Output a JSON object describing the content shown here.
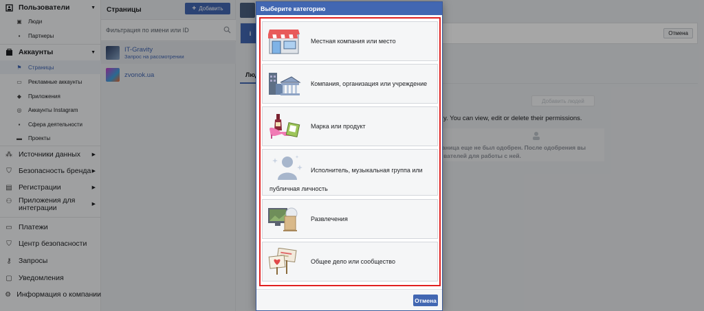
{
  "sidebar": {
    "users_section": "Пользователи",
    "people": "Люди",
    "partners": "Партнеры",
    "accounts_section": "Аккаунты",
    "pages": "Страницы",
    "ad_accounts": "Рекламные аккаунты",
    "apps": "Приложения",
    "instagram_accounts": "Аккаунты Instagram",
    "lines_of_business": "Сфера деятельности",
    "projects": "Проекты",
    "data_sources": "Источники данных",
    "brand_safety": "Безопасность бренда",
    "registrations": "Регистрации",
    "integrations": "Приложения для интеграции",
    "payments": "Платежи",
    "security_center": "Центр безопасности",
    "requests": "Запросы",
    "notifications": "Уведомления",
    "business_info": "Информация о компании"
  },
  "pages_panel": {
    "title": "Страницы",
    "add_button": "Добавить",
    "filter_placeholder": "Фильтрация по имени или ID",
    "items": [
      {
        "name": "IT-Gravity",
        "status": "Запрос на рассмотрении"
      },
      {
        "name": "zvonok.ua",
        "status": ""
      }
    ]
  },
  "main": {
    "cancel_button": "Отмена",
    "tab_people": "Люди",
    "add_people_button": "Добавить людей",
    "permissions_text": "y. You can view, edit or delete their permissions.",
    "notice_line1": "аница еще не был одобрен. После одобрения вы",
    "notice_line2": "вателей для работы с ней."
  },
  "dialog": {
    "title": "Выберите категорию",
    "categories": [
      {
        "label": "Местная компания или место",
        "icon": "storefront-icon"
      },
      {
        "label": "Компания, организация или учреждение",
        "icon": "institution-icon"
      },
      {
        "label": "Марка или продукт",
        "icon": "product-icon"
      },
      {
        "label": "Исполнитель, музыкальная группа или",
        "label2": "публичная личность",
        "icon": "public-figure-icon"
      },
      {
        "label": "Развлечения",
        "icon": "entertainment-icon"
      },
      {
        "label": "Общее дело или сообщество",
        "icon": "community-signs-icon"
      }
    ],
    "cancel_button": "Отмена"
  },
  "colors": {
    "brand": "#4267b2",
    "highlight_frame": "#e02020"
  }
}
